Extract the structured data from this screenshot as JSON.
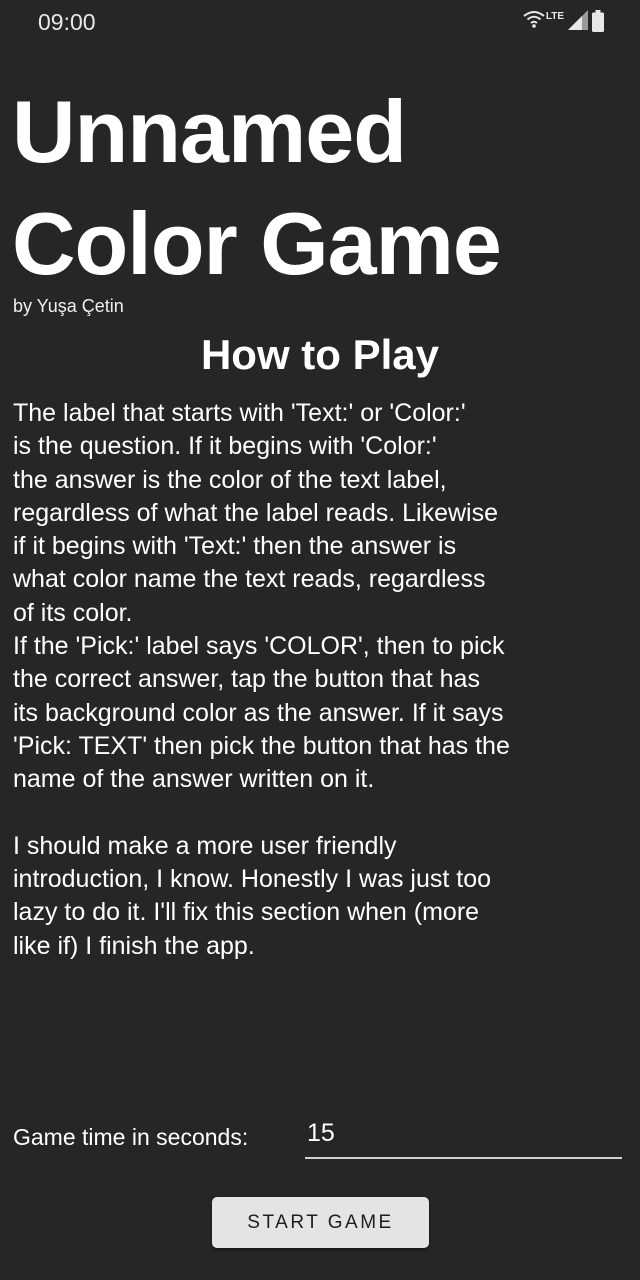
{
  "status_bar": {
    "time": "09:00",
    "network": "LTE",
    "icons": [
      "wifi-icon",
      "signal-icon",
      "battery-icon"
    ]
  },
  "header": {
    "title_line1": "Unnamed",
    "title_line2": "Color Game",
    "byline": "by Yuşa Çetin"
  },
  "how_to_play": {
    "heading": "How to Play",
    "lines": [
      "The label that starts with 'Text:' or 'Color:'",
      "is the question. If it begins with 'Color:'",
      "the answer is the color of the text label,",
      "regardless of what the label reads. Likewise",
      "if it begins with 'Text:' then the answer is",
      "what color name the text reads, regardless",
      "of its color.",
      "If the 'Pick:' label says 'COLOR', then to pick",
      "the correct answer, tap the button that has",
      "its background color as the answer. If it says",
      "'Pick: TEXT' then pick the button that has the",
      "name of the answer written on it.",
      "",
      "I should make a more user friendly",
      "introduction, I know. Honestly I was just too",
      "lazy to do it. I'll fix this section when (more",
      "like if) I finish the app."
    ]
  },
  "settings": {
    "game_time_label": "Game time in seconds:",
    "game_time_value": "15"
  },
  "actions": {
    "start_label": "START GAME"
  },
  "colors": {
    "background": "#262626",
    "text": "#ffffff",
    "button_bg": "#e4e4e4",
    "button_text": "#1e1e1e"
  }
}
